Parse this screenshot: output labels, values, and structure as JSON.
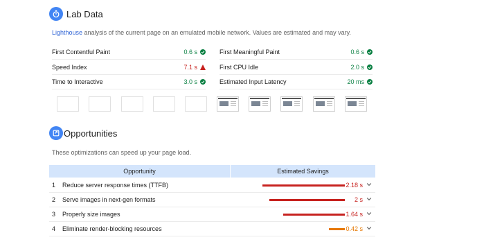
{
  "lab": {
    "title": "Lab Data",
    "intro_link": "Lighthouse",
    "intro_text": " analysis of the current page on an emulated mobile network. Values are estimated and may vary.",
    "metrics_left": [
      {
        "label": "First Contentful Paint",
        "value": "0.6 s",
        "status": "pass"
      },
      {
        "label": "Speed Index",
        "value": "7.1 s",
        "status": "fail"
      },
      {
        "label": "Time to Interactive",
        "value": "3.0 s",
        "status": "pass"
      }
    ],
    "metrics_right": [
      {
        "label": "First Meaningful Paint",
        "value": "0.6 s",
        "status": "pass"
      },
      {
        "label": "First CPU Idle",
        "value": "2.0 s",
        "status": "pass"
      },
      {
        "label": "Estimated Input Latency",
        "value": "20 ms",
        "status": "pass"
      }
    ]
  },
  "opportunities": {
    "title": "Opportunities",
    "description": "These optimizations can speed up your page load.",
    "col_opportunity": "Opportunity",
    "col_savings": "Estimated Savings",
    "rows": [
      {
        "num": "1",
        "name": "Reduce server response times (TTFB)",
        "savings": "2.18 s",
        "fraction": 1.0,
        "severity": "fail"
      },
      {
        "num": "2",
        "name": "Serve images in next-gen formats",
        "savings": "2 s",
        "fraction": 0.92,
        "severity": "fail"
      },
      {
        "num": "3",
        "name": "Properly size images",
        "savings": "1.64 s",
        "fraction": 0.75,
        "severity": "fail"
      },
      {
        "num": "4",
        "name": "Eliminate render-blocking resources",
        "savings": "0.42 s",
        "fraction": 0.19,
        "severity": "average"
      }
    ]
  },
  "colors": {
    "accent": "#4285f4",
    "pass": "#0b8043",
    "fail": "#c7221f",
    "average": "#e67700",
    "table_header": "#d4e5fc"
  },
  "icons": {
    "lab": "stopwatch-icon",
    "opportunities": "opportunity-icon",
    "pass": "check-circle-icon",
    "fail": "warning-triangle-icon",
    "expand": "chevron-down-icon"
  }
}
